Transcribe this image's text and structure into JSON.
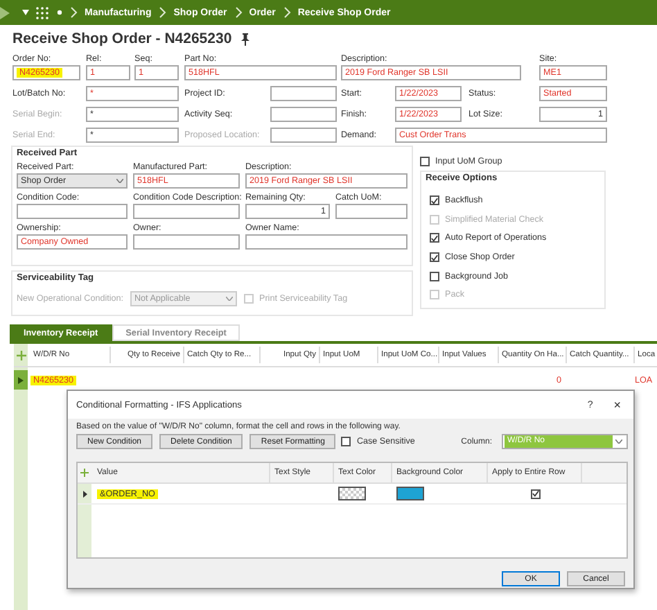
{
  "breadcrumb": [
    "Manufacturing",
    "Shop Order",
    "Order",
    "Receive Shop Order"
  ],
  "title": "Receive Shop Order - N4265230",
  "order_fields": [
    {
      "label": "Order No:",
      "value": "N4265230",
      "required": true,
      "highlighted": true
    },
    {
      "label": "Rel:",
      "value": "1",
      "required": true,
      "highlighted": false
    },
    {
      "label": "Seq:",
      "value": "1",
      "required": true,
      "highlighted": false
    },
    {
      "label": "Part No:",
      "value": "518HFL",
      "required": true,
      "highlighted": false
    },
    {
      "label": "Description:",
      "value": "2019 Ford Ranger SB LSII",
      "required": true,
      "highlighted": false
    },
    {
      "label": "Site:",
      "value": "ME1",
      "required": true,
      "highlighted": false
    }
  ],
  "detail_rows": [
    [
      {
        "label": "Lot/Batch No:",
        "value": "*",
        "required": true,
        "label_disabled": false,
        "kind": "text"
      },
      {
        "label": "Project ID:",
        "label_disabled": false,
        "kind": "text"
      },
      {
        "label": "Start:",
        "value": "1/22/2023",
        "required": true,
        "label_disabled": false,
        "kind": "text"
      },
      {
        "label": "Status:",
        "value": "Started",
        "required": true,
        "label_disabled": false,
        "kind": "text"
      }
    ],
    [
      {
        "label": "Serial Begin:",
        "value": "*",
        "required": false,
        "label_disabled": true,
        "kind": "text"
      },
      {
        "label": "Activity Seq:",
        "label_disabled": false,
        "kind": "text"
      },
      {
        "label": "Finish:",
        "value": "1/22/2023",
        "required": true,
        "label_disabled": false,
        "kind": "text"
      },
      {
        "label": "Lot Size:",
        "value": "1",
        "required": false,
        "label_disabled": false,
        "kind": "number"
      }
    ],
    [
      {
        "label": "Serial End:",
        "value": "*",
        "required": false,
        "label_disabled": true,
        "kind": "text"
      },
      {
        "label": "Proposed Location:",
        "label_disabled": true,
        "kind": "text"
      },
      {
        "label": "Demand:",
        "value": "Cust Order Trans",
        "required": true,
        "label_disabled": false,
        "kind": "text"
      }
    ]
  ],
  "received_part": {
    "title": "Received Part",
    "fields": [
      {
        "label": "Received Part:",
        "value": "Shop Order",
        "required": false,
        "kind": "dropdown"
      },
      {
        "label": "Manufactured Part:",
        "value": "518HFL",
        "required": true,
        "kind": "text"
      },
      {
        "label": "Description:",
        "value": "2019 Ford Ranger SB LSII",
        "required": true,
        "kind": "text"
      },
      {
        "label": "Condition Code:",
        "kind": "text"
      },
      {
        "label": "Condition Code Description:",
        "kind": "text"
      },
      {
        "label": "Remaining Qty:",
        "value": "1",
        "required": false,
        "kind": "number"
      },
      {
        "label": "Catch UoM:",
        "kind": "text"
      },
      {
        "label": "Ownership:",
        "value": "Company Owned",
        "required": true,
        "kind": "text"
      },
      {
        "label": "Owner:",
        "kind": "text"
      },
      {
        "label": "Owner Name:",
        "kind": "text"
      }
    ]
  },
  "serviceability": {
    "title": "Serviceability Tag",
    "label": "New Operational Condition:",
    "value": "Not Applicable",
    "disabled": true,
    "print_tag": {
      "label": "Print Serviceability Tag",
      "checked": false,
      "disabled": true
    }
  },
  "input_uom_group": {
    "label": "Input UoM Group",
    "checked": false,
    "disabled": false
  },
  "receive_options": {
    "title": "Receive Options",
    "items": [
      {
        "label": "Backflush",
        "checked": true,
        "disabled": false
      },
      {
        "label": "Simplified Material Check",
        "checked": false,
        "disabled": true
      },
      {
        "label": "Auto Report of Operations",
        "checked": true,
        "disabled": false
      },
      {
        "label": "Close Shop Order",
        "checked": true,
        "disabled": false
      },
      {
        "label": "Background Job",
        "checked": false,
        "disabled": false
      },
      {
        "label": "Pack",
        "checked": false,
        "disabled": true
      }
    ]
  },
  "tabs": [
    {
      "label": "Inventory Receipt",
      "selected": true
    },
    {
      "label": "Serial Inventory Receipt",
      "selected": false
    }
  ],
  "table": {
    "columns": [
      "W/D/R No",
      "Qty to Receive",
      "Catch Qty to Re...",
      "Input Qty",
      "Input UoM",
      "Input UoM Co...",
      "Input Values",
      "Quantity On Ha...",
      "Catch Quantity...",
      "Loca"
    ],
    "rows": [
      {
        "wdr_no": "N4265230",
        "wdr_no_highlighted": true,
        "quantity_on_hand": "0",
        "location": "LOA"
      }
    ]
  },
  "dialog": {
    "title": "Conditional Formatting - IFS Applications",
    "help": "?",
    "close": "×",
    "description": "Based on the value of \"W/D/R No\" column, format the cell and rows in the following way.",
    "buttons": [
      "New Condition",
      "Delete Condition",
      "Reset Formatting"
    ],
    "case_sensitive": {
      "label": "Case Sensitive",
      "checked": false
    },
    "column_label": "Column:",
    "column_value": "W/D/R No",
    "grid_columns": [
      "Value",
      "Text Style",
      "Text Color",
      "Background Color",
      "Apply to Entire Row"
    ],
    "rows": [
      {
        "value": "&ORDER_NO",
        "highlighted": true,
        "apply_to_entire_row": true
      }
    ],
    "ok": "OK",
    "cancel": "Cancel"
  }
}
